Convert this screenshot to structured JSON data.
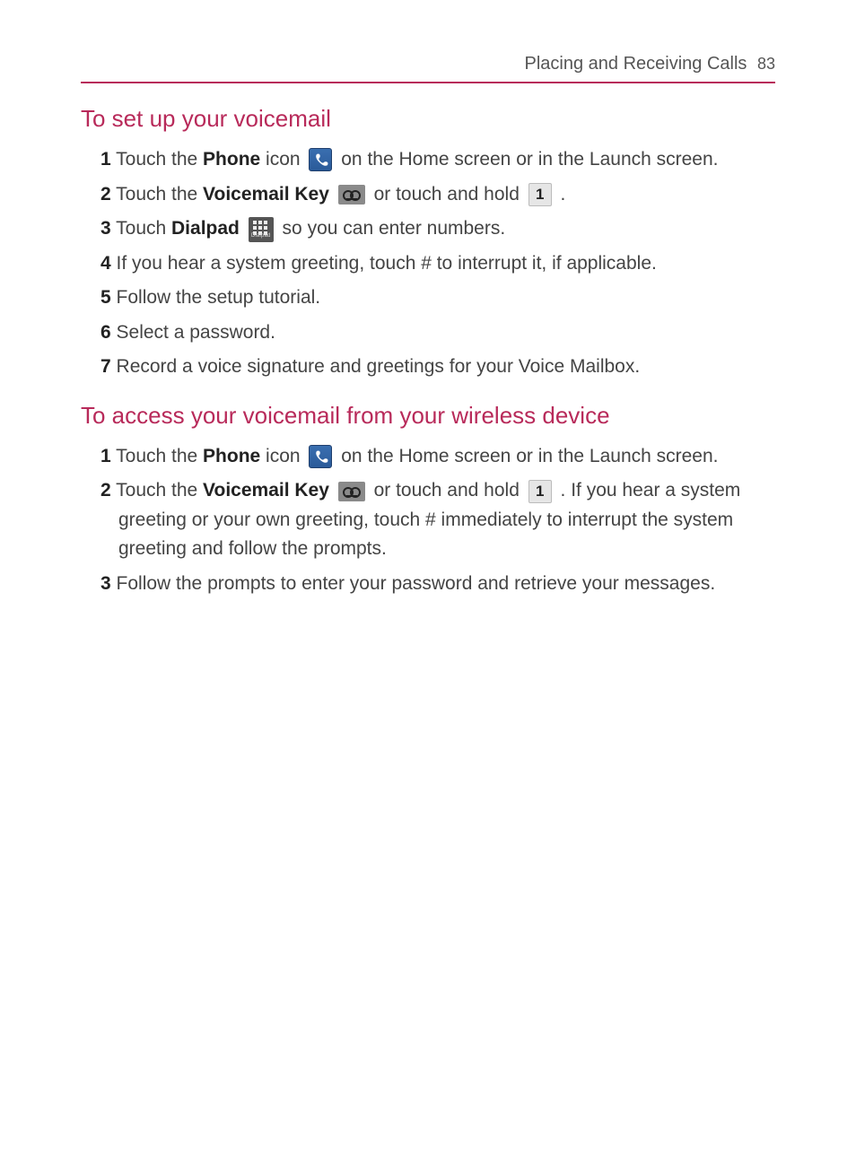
{
  "header": {
    "chapter": "Placing and Receiving Calls",
    "page": "83"
  },
  "sections": [
    {
      "title": "To set up your voicemail",
      "steps": [
        {
          "num": "1",
          "parts": [
            {
              "t": "text",
              "v": " Touch the "
            },
            {
              "t": "bold",
              "v": "Phone"
            },
            {
              "t": "text",
              "v": " icon "
            },
            {
              "t": "icon",
              "v": "phone"
            },
            {
              "t": "text",
              "v": " on the Home screen or in the Launch screen."
            }
          ]
        },
        {
          "num": "2",
          "parts": [
            {
              "t": "text",
              "v": " Touch the "
            },
            {
              "t": "bold",
              "v": "Voicemail Key"
            },
            {
              "t": "text",
              "v": " "
            },
            {
              "t": "icon",
              "v": "voicemail"
            },
            {
              "t": "text",
              "v": " or touch and hold "
            },
            {
              "t": "icon",
              "v": "key1"
            },
            {
              "t": "text",
              "v": " ."
            }
          ]
        },
        {
          "num": "3",
          "parts": [
            {
              "t": "text",
              "v": " Touch "
            },
            {
              "t": "bold",
              "v": "Dialpad"
            },
            {
              "t": "text",
              "v": " "
            },
            {
              "t": "icon",
              "v": "dialpad"
            },
            {
              "t": "text",
              "v": " so you can enter numbers."
            }
          ]
        },
        {
          "num": "4",
          "parts": [
            {
              "t": "text",
              "v": " If you hear a system greeting, touch # to interrupt it, if applicable."
            }
          ]
        },
        {
          "num": "5",
          "parts": [
            {
              "t": "text",
              "v": " Follow the setup tutorial."
            }
          ]
        },
        {
          "num": "6",
          "parts": [
            {
              "t": "text",
              "v": " Select a password."
            }
          ]
        },
        {
          "num": "7",
          "parts": [
            {
              "t": "text",
              "v": " Record a voice signature and greetings for your Voice Mailbox."
            }
          ]
        }
      ]
    },
    {
      "title": "To access your voicemail from your wireless device",
      "steps": [
        {
          "num": "1",
          "parts": [
            {
              "t": "text",
              "v": " Touch the "
            },
            {
              "t": "bold",
              "v": "Phone"
            },
            {
              "t": "text",
              "v": " icon "
            },
            {
              "t": "icon",
              "v": "phone"
            },
            {
              "t": "text",
              "v": " on the Home screen or in the Launch screen."
            }
          ]
        },
        {
          "num": "2",
          "parts": [
            {
              "t": "text",
              "v": " Touch the "
            },
            {
              "t": "bold",
              "v": "Voicemail Key"
            },
            {
              "t": "text",
              "v": " "
            },
            {
              "t": "icon",
              "v": "voicemail"
            },
            {
              "t": "text",
              "v": " or touch and hold "
            },
            {
              "t": "icon",
              "v": "key1"
            },
            {
              "t": "text",
              "v": " . If you hear a system greeting or your own greeting, touch # immediately to interrupt the system greeting and follow the prompts."
            }
          ]
        },
        {
          "num": "3",
          "parts": [
            {
              "t": "text",
              "v": " Follow the prompts to enter your password and retrieve your messages."
            }
          ]
        }
      ]
    }
  ],
  "icon_labels": {
    "phone": "phone-icon",
    "voicemail": "voicemail-key-icon",
    "key1": "keypad-1-icon",
    "dialpad": "dialpad-icon",
    "dialpad_text": "Dialpad"
  }
}
